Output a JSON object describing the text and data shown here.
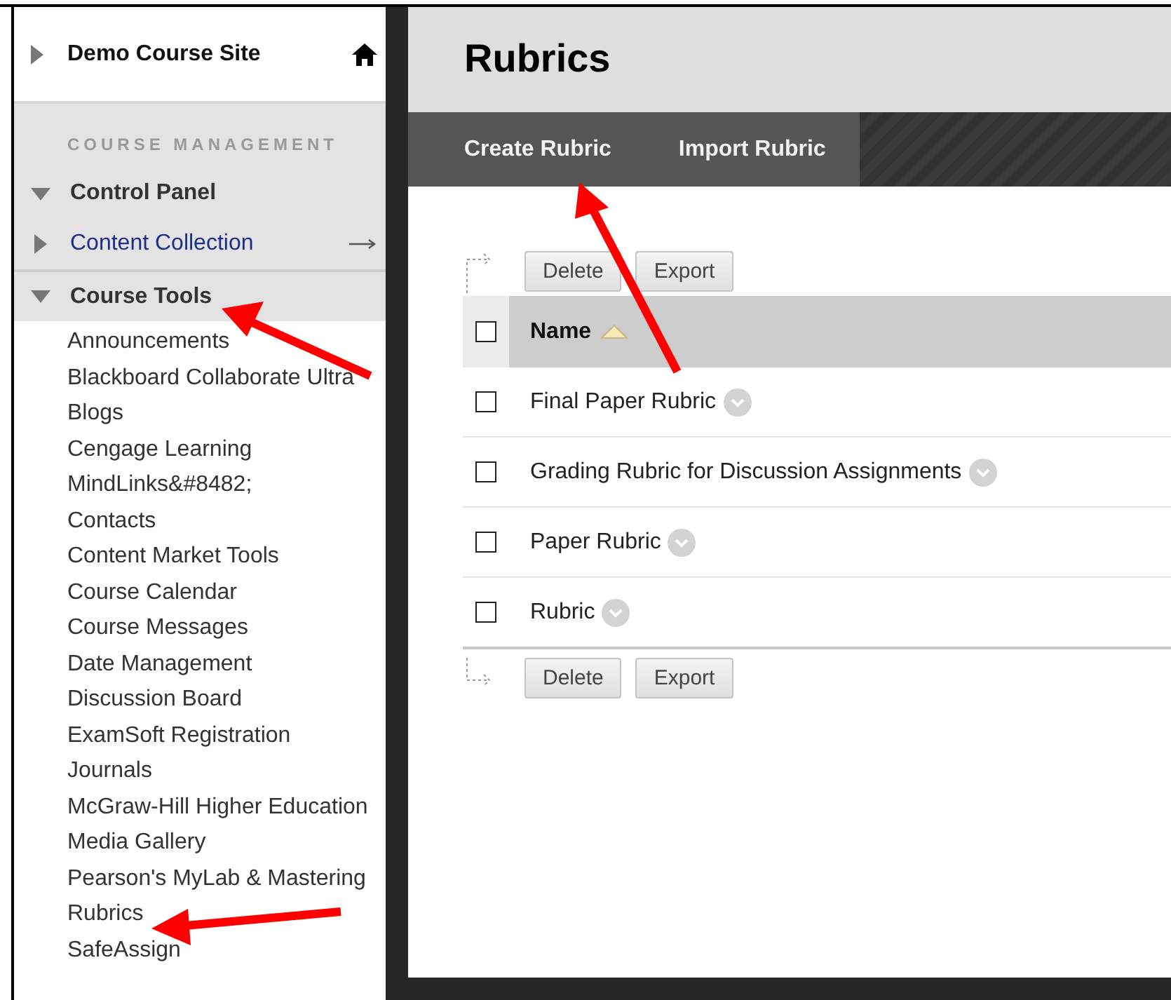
{
  "sidebar": {
    "course_title": "Demo Course Site",
    "section_label": "COURSE MANAGEMENT",
    "menu": [
      {
        "label": "Control Panel",
        "kind": "header",
        "expanded": true
      },
      {
        "label": "Content Collection",
        "kind": "link",
        "expanded": false
      },
      {
        "label": "Course Tools",
        "kind": "header",
        "expanded": true,
        "children": [
          "Announcements",
          "Blackboard Collaborate Ultra",
          "Blogs",
          "Cengage Learning MindLinks&#8482;",
          "Contacts",
          "Content Market Tools",
          "Course Calendar",
          "Course Messages",
          "Date Management",
          "Discussion Board",
          "ExamSoft Registration",
          "Journals",
          "McGraw-Hill Higher Education",
          "Media Gallery",
          "Pearson's MyLab & Mastering",
          "Rubrics",
          "SafeAssign"
        ]
      }
    ]
  },
  "page_title": "Rubrics",
  "action_bar": [
    "Create Rubric",
    "Import Rubric"
  ],
  "top_buttons": [
    "Delete",
    "Export"
  ],
  "table": {
    "columns": [
      {
        "label": "Name",
        "sorted": true
      }
    ],
    "select_all_checked": false,
    "rows": [
      {
        "name": "Final Paper Rubric",
        "checked": false
      },
      {
        "name": "Grading Rubric for Discussion Assignments",
        "checked": false
      },
      {
        "name": "Paper Rubric",
        "checked": false
      },
      {
        "name": "Rubric",
        "checked": false
      }
    ]
  },
  "bottom_buttons": [
    "Delete",
    "Export"
  ]
}
